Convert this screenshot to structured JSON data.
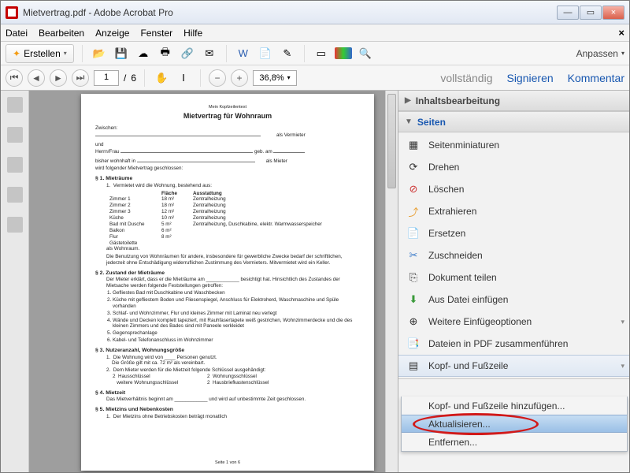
{
  "window": {
    "title": "Mietvertrag.pdf - Adobe Acrobat Pro",
    "min": "—",
    "max": "▭",
    "close": "×"
  },
  "menu": {
    "items": [
      "Datei",
      "Bearbeiten",
      "Anzeige",
      "Fenster",
      "Hilfe"
    ],
    "close_x": "×"
  },
  "toolbar1": {
    "create": "Erstellen",
    "anpassen": "Anpassen"
  },
  "toolbar2": {
    "page_current": "1",
    "page_sep": "/",
    "page_total": "6",
    "zoom": "36,8%",
    "vollstaendig": "vollständig",
    "signieren": "Signieren",
    "kommentar": "Kommentar"
  },
  "sidebar": {
    "sec1": "Inhaltsbearbeitung",
    "sec2": "Seiten",
    "items": [
      {
        "label": "Seitenminiaturen"
      },
      {
        "label": "Drehen"
      },
      {
        "label": "Löschen"
      },
      {
        "label": "Extrahieren"
      },
      {
        "label": "Ersetzen"
      },
      {
        "label": "Zuschneiden"
      },
      {
        "label": "Dokument teilen"
      },
      {
        "label": "Aus Datei einfügen"
      },
      {
        "label": "Weitere Einfügeoptionen"
      },
      {
        "label": "Dateien in PDF zusammenführen"
      },
      {
        "label": "Kopf- und Fußzeile"
      }
    ],
    "submenu": {
      "add": "Kopf- und Fußzeile hinzufügen...",
      "update": "Aktualisieren...",
      "remove": "Entfernen..."
    }
  },
  "doc": {
    "header_small": "Mein Kopfzeilentext",
    "title": "Mietvertrag für Wohnraum",
    "zwischen": "Zwischen:",
    "als_vermieter": "als Vermieter",
    "und": "und",
    "herrn": "Herrn/Frau",
    "geb": "geb. am",
    "bisher": "bisher wohnhaft in",
    "als_mieter": "als Mieter",
    "wird": "wird folgender Mietvertrag geschlossen:",
    "s1": "§ 1. Mieträume",
    "s1_1": "Vermietet wird die Wohnung, bestehend aus:",
    "th1": "Fläche",
    "th2": "Ausstattung",
    "rows": [
      {
        "n": "Zimmer 1",
        "f": "18 m²",
        "a": "Zentralheizung"
      },
      {
        "n": "Zimmer 2",
        "f": "18 m²",
        "a": "Zentralheizung"
      },
      {
        "n": "Zimmer 3",
        "f": "12 m²",
        "a": "Zentralheizung"
      },
      {
        "n": "Küche",
        "f": "10 m²",
        "a": "Zentralheizung"
      },
      {
        "n": "Bad mit Dusche",
        "f": "5 m²",
        "a": "Zentralheizung, Duschkabine, elektr. Warmwasserspeicher"
      },
      {
        "n": "Balkon",
        "f": "6 m²",
        "a": ""
      },
      {
        "n": "Flur",
        "f": "8 m²",
        "a": ""
      },
      {
        "n": "Gästetoilette",
        "f": "",
        "a": ""
      }
    ],
    "als_wohn": "als Wohnraum.",
    "s1_p": "Die Benutzung von Wohnräumen für andere, insbesondere für gewerbliche Zwecke bedarf der schriftlichen, jederzeit ohne Entschädigung widerruflichen Zustimmung des Vermieters. Mitvermietet wird ein Keller.",
    "s2": "§ 2. Zustand der Mieträume",
    "s2_p": "Der Mieter erklärt, dass er die Mieträume am ____________ besichtigt hat. Hinsichtlich des Zustandes der Mietsache werden folgende Feststellungen getroffen:",
    "s2_list": [
      "Gefliestes Bad mit Duschkabine und Waschbecken",
      "Küche mit gefliestem Boden und Fliesenspiegel, Anschluss für Elektroherd, Waschmaschine und Spüle vorhanden",
      "Schlaf- und Wohnzimmer, Flur und kleines Zimmer mit Laminat neu verlegt",
      "Wände und Decken komplett tapeziert, mit Rauhfasertapete weiß gestrichen, Wohnzimmerdecke und die des kleinen Zimmers und des Bades sind mit Paneele verkleidet",
      "Gegensprechanlage",
      "Kabel- und Telefonanschluss im Wohnzimmer"
    ],
    "s3": "§ 3. Nutzeranzahl, Wohnungsgröße",
    "s3_1": "Die Wohnung wird von ____ Personen genutzt.",
    "s3_2": "Die Größe gilt mit ca. 72 m² als vereinbart.",
    "s3_3": "Dem Mieter werden für die Mietzeit folgende Schlüssel ausgehändigt:",
    "s3_k": [
      [
        "2",
        "Hausschlüssel",
        "2",
        "Wohnungsschlüssel"
      ],
      [
        "",
        "weitere Wohnungsschlüssel",
        "2",
        "Hausbriefkastenschlüssel"
      ]
    ],
    "s4": "§ 4. Mietzeit",
    "s4_p": "Das Mietverhältnis beginnt am ____________ und wird auf unbestimmte Zeit geschlossen.",
    "s5": "§ 5. Mietzins und Nebenkosten",
    "s5_1": "Der Mietzins ohne Betriebskosten beträgt monatlich",
    "footer": "Seite 1 von 6"
  }
}
